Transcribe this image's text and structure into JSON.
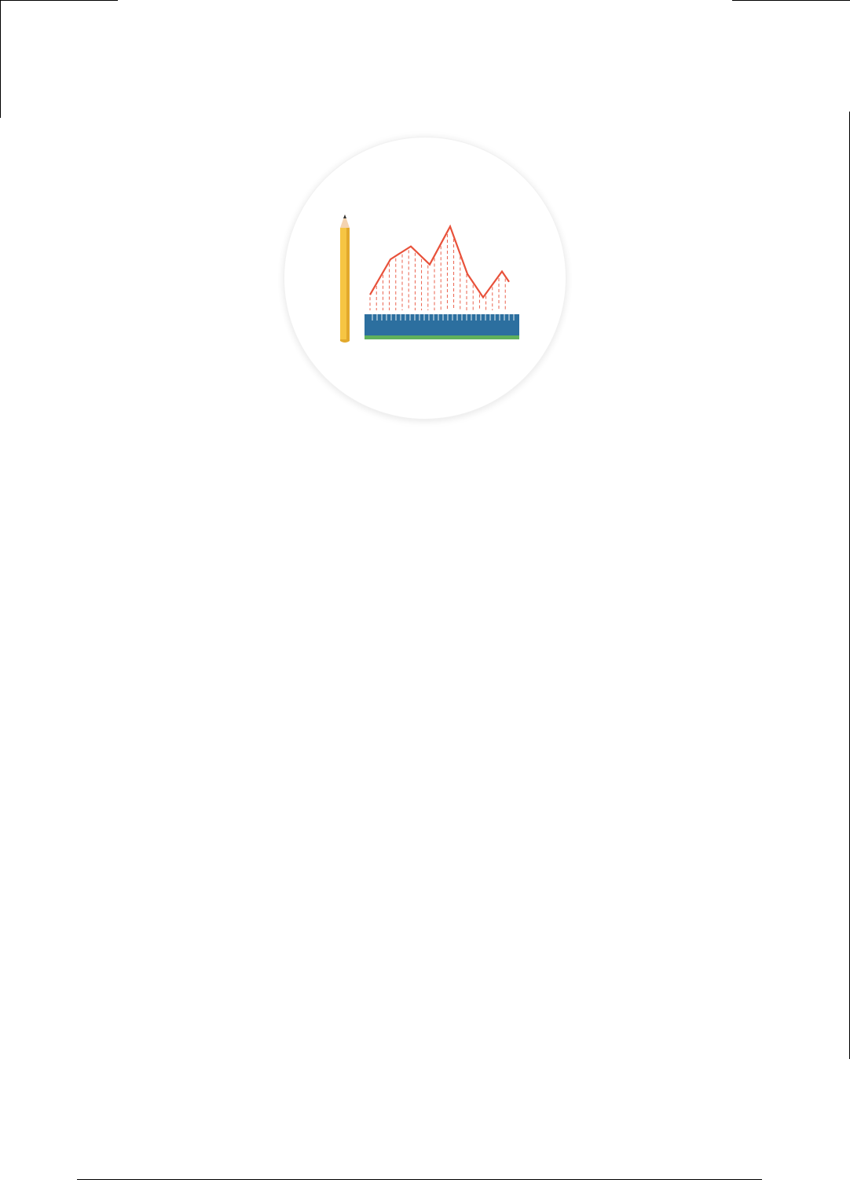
{
  "page": {
    "background": "#ffffff"
  },
  "illustration": {
    "icon": "pencil-ruler-line-chart-icon",
    "colors": {
      "circle_fill": "#ffffff",
      "pencil_body": "#f6c543",
      "pencil_stripe": "#e2a92c",
      "pencil_wood": "#f4d3b0",
      "pencil_lead": "#333333",
      "ruler": "#2c6f9f",
      "ruler_edge": "#5fb05c",
      "ruler_ticks": "#ffffff",
      "chart_line": "#e8513a"
    },
    "line_profile": [
      0.18,
      0.59,
      0.74,
      0.53,
      0.97,
      0.42,
      0.15,
      0.45,
      0.33
    ]
  }
}
